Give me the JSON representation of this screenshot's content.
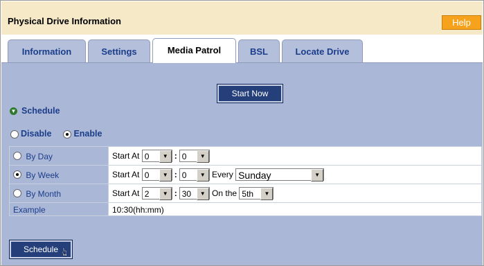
{
  "header": {
    "title": "Physical Drive Information",
    "help_label": "Help"
  },
  "tabs": [
    {
      "label": "Information",
      "active": false
    },
    {
      "label": "Settings",
      "active": false
    },
    {
      "label": "Media Patrol",
      "active": true
    },
    {
      "label": "BSL",
      "active": false
    },
    {
      "label": "Locate Drive",
      "active": false
    }
  ],
  "actions": {
    "start_now_label": "Start Now",
    "schedule_label": "Schedule"
  },
  "schedule": {
    "heading": "Schedule",
    "disable_label": "Disable",
    "enable_label": "Enable",
    "selected": "Enable",
    "rows": [
      {
        "label": "By Day",
        "selected": false,
        "start_at_label": "Start At",
        "hour": "0",
        "minute": "0"
      },
      {
        "label": "By Week",
        "selected": true,
        "start_at_label": "Start At",
        "hour": "0",
        "minute": "0",
        "every_label": "Every",
        "day": "Sunday"
      },
      {
        "label": "By Month",
        "selected": false,
        "start_at_label": "Start At",
        "hour": "2",
        "minute": "30",
        "on_the_label": "On the",
        "date": "5th"
      }
    ],
    "example_label": "Example",
    "example_value": "10:30(hh:mm)"
  },
  "colors": {
    "accent_orange": "#f6a21d",
    "header_bg": "#f5e9c7",
    "panel_bg": "#aab7d6",
    "button_bg": "#243f7a",
    "label_blue": "#1b3d8a"
  }
}
